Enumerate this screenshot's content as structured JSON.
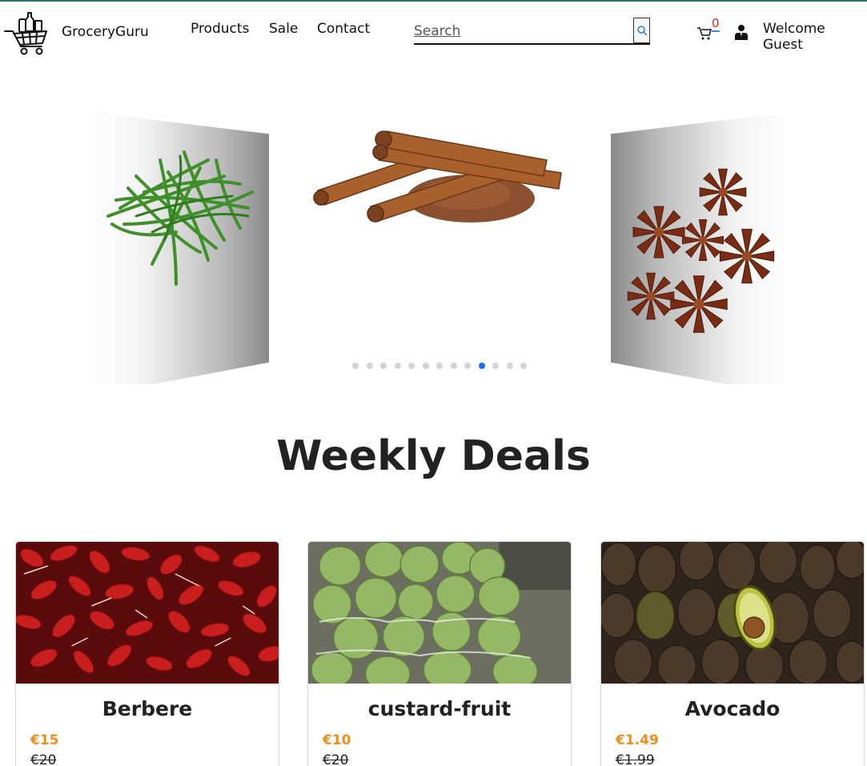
{
  "header": {
    "brand": "GroceryGuru",
    "nav": [
      {
        "label": "Products"
      },
      {
        "label": "Sale"
      },
      {
        "label": "Contact"
      }
    ],
    "search": {
      "placeholder": "Search",
      "value": ""
    },
    "cart_count": "0",
    "welcome": "Welcome Guest"
  },
  "carousel": {
    "slides": [
      "green-beans",
      "cinnamon",
      "star-anise"
    ],
    "dot_count": 13,
    "active_dot": 9,
    "accent_color": "#1b6ff5"
  },
  "section_title": "Weekly Deals",
  "deals": [
    {
      "name": "Berbere",
      "price": "€15",
      "old_price": "€20"
    },
    {
      "name": "custard-fruit",
      "price": "€10",
      "old_price": "€20"
    },
    {
      "name": "Avocado",
      "price": "€1.49",
      "old_price": "€1.99"
    }
  ],
  "colors": {
    "price": "#f08c1a",
    "cart_badge": "#e02020"
  }
}
